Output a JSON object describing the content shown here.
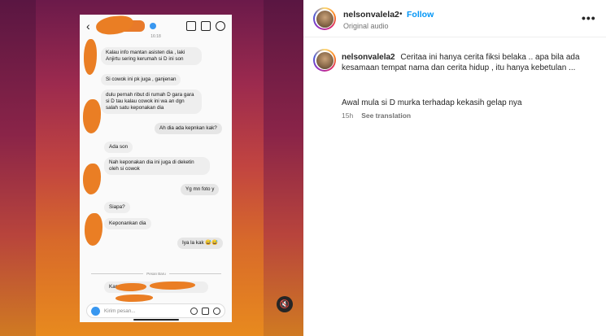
{
  "post": {
    "username": "nelsonvalela2",
    "separator": "•",
    "follow_label": "Follow",
    "audio_label": "Original audio",
    "more_label": "•••"
  },
  "caption": {
    "username": "nelsonvalela2",
    "text": "Ceritaa ini hanya cerita fiksi belaka .. apa bila ada kesamaan tempat nama dan cerita hidup , itu hanya kebetulan ..."
  },
  "comment": {
    "text": "Awal mula si D murka terhadap kekasih gelap nya",
    "time": "15h",
    "see_translation": "See translation"
  },
  "chat": {
    "timestamp": "16:18",
    "messages": [
      {
        "side": "in",
        "text": "Kalau info mantan asisten dia , laki Anjirtu sering kerumah si D ini son"
      },
      {
        "side": "in",
        "text": "Si cowok ini pk juga , ganjenan"
      },
      {
        "side": "in",
        "text": "dulu pernah ribut di rumah D gara gara si D tau kalau cowok ini wa an dgn salah satu keponakan dia"
      },
      {
        "side": "out",
        "text": "Ah dia ada kepnkan kak?"
      },
      {
        "side": "in",
        "text": "Ada son"
      },
      {
        "side": "in",
        "text": "Nah keponakan dia ini juga di deketin oleh si cowok"
      },
      {
        "side": "out",
        "text": "Yg mn foto y"
      },
      {
        "side": "in",
        "text": "Siapa?"
      },
      {
        "side": "in",
        "text": "Keponankan dia"
      },
      {
        "side": "out",
        "text": "Iya la kak 😅😅"
      },
      {
        "side": "in",
        "text": "Kamu lihat aja"
      }
    ],
    "divider_label": "Pesan Baru",
    "composer_placeholder": "Kirim pesan..."
  },
  "colors": {
    "accent": "#0095f6",
    "blur_mark": "#ea7e24"
  },
  "icons": {
    "mute": "speaker-muted-icon"
  }
}
